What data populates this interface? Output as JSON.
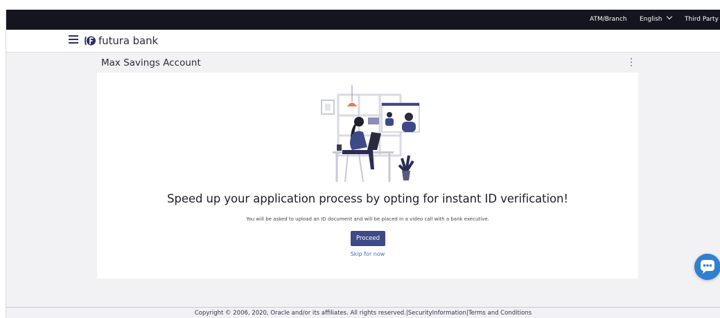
{
  "topbar": {
    "atm_branch": "ATM/Branch",
    "language": "English",
    "third_party": "Third Party"
  },
  "header": {
    "brand": "futura bank"
  },
  "page": {
    "title": "Max Savings Account",
    "headline": "Speed up your application process by opting for instant ID verification!",
    "subtext": "You will be asked to upload an ID document and will be placed in a video call with a bank executive.",
    "proceed_label": "Proceed",
    "skip_label": "Skip for now"
  },
  "footer": {
    "copyright": "Copyright © 2006, 2020, Oracle and/or its affiliates. All rights reserved.|",
    "security_link": "SecurityInformation",
    "separator": "|",
    "terms_link": "Terms and Conditions"
  },
  "colors": {
    "topbar_bg": "#14151f",
    "primary_button": "#3e4a87",
    "link": "#3d6bc4",
    "chat_button": "#2f80d0"
  },
  "icons": {
    "menu": "hamburger-icon",
    "logo": "futura-logo-icon",
    "language_dropdown": "chevron-down-icon",
    "third_party_dropdown": "chevron-down-icon",
    "more_options": "kebab-icon",
    "chat": "chat-icon"
  }
}
